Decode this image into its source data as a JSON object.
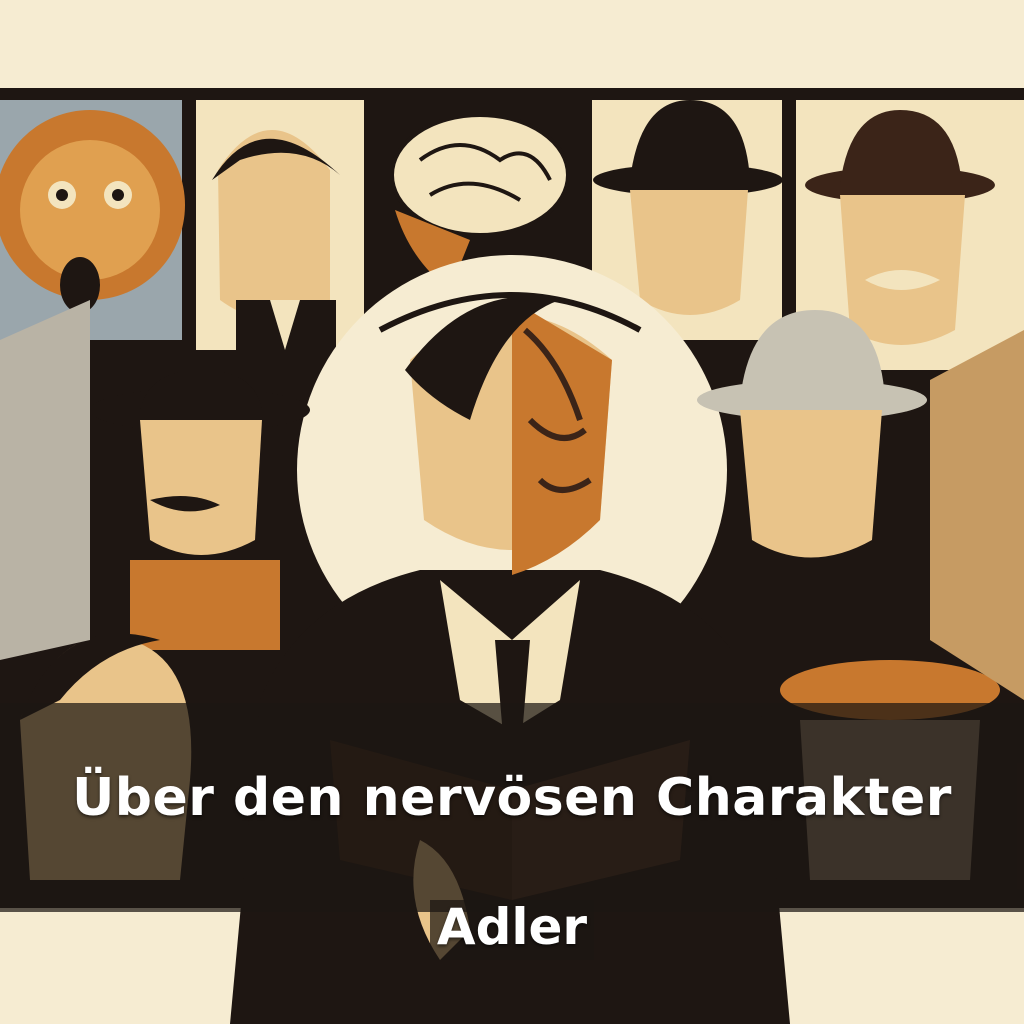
{
  "cover": {
    "title": "Über den nervösen Charakter",
    "author": "Adler"
  },
  "palette": {
    "paper": "#f6ecd2",
    "ink": "#1e1612",
    "brown": "#3b2418",
    "amber": "#c8782e",
    "gray": "#8e9aa2",
    "cream": "#f3e4be"
  }
}
